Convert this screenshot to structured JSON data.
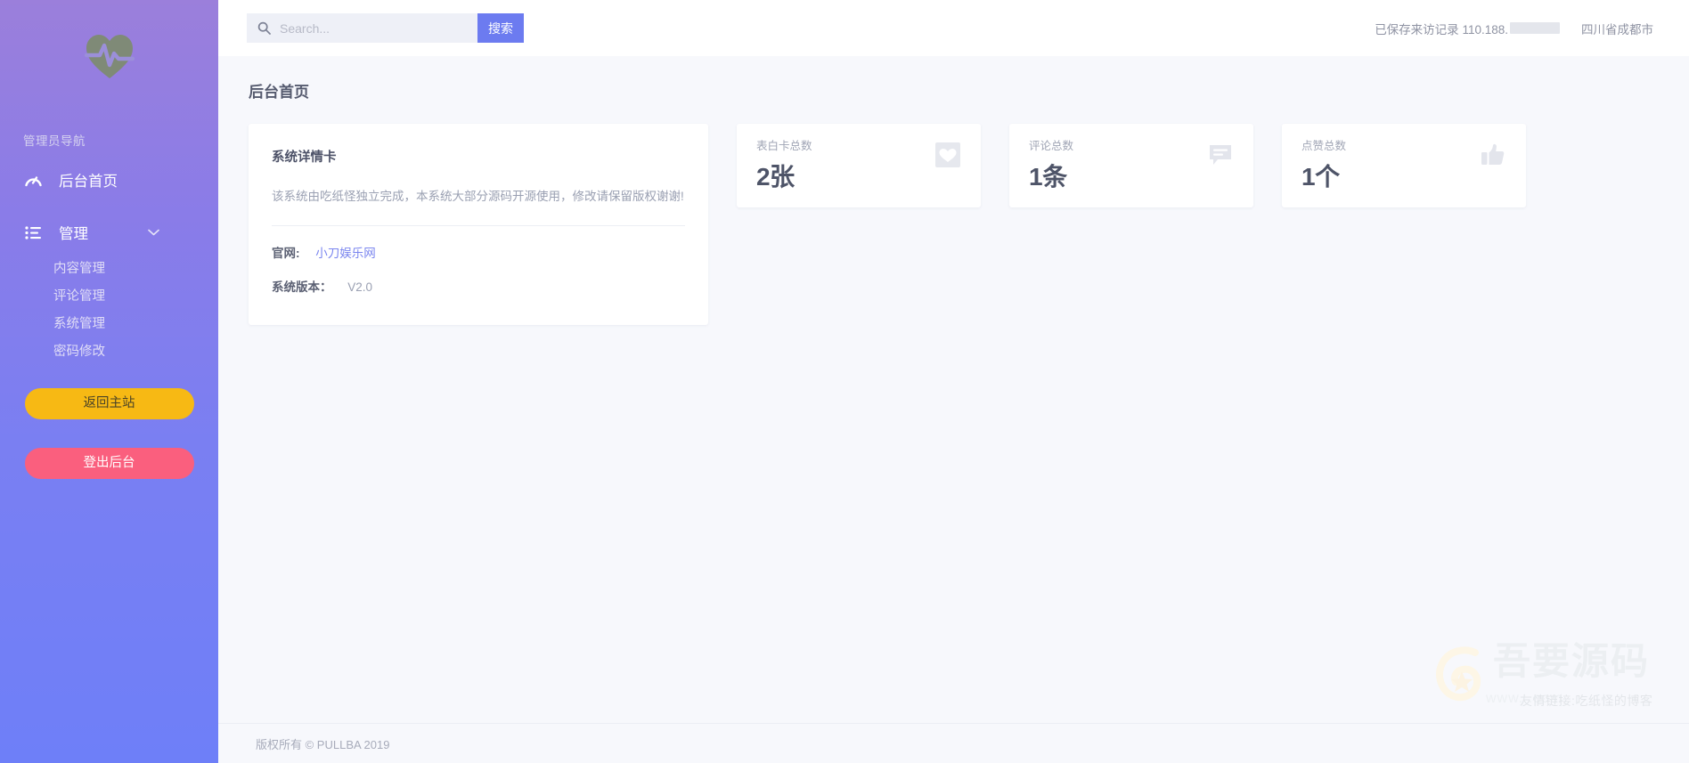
{
  "sidebar": {
    "logo_icon": "heart-pulse-logo",
    "nav_title": "管理员导航",
    "items": [
      {
        "label": "后台首页",
        "icon": "speedometer-icon"
      },
      {
        "label": "管理",
        "icon": "list-icon",
        "chevron": "⌄"
      }
    ],
    "sub_items": [
      {
        "label": "内容管理"
      },
      {
        "label": "评论管理"
      },
      {
        "label": "系统管理"
      },
      {
        "label": "密码修改"
      }
    ],
    "home_button": "返回主站",
    "logout_button": "登出后台",
    "home_button_color": "#f7b914",
    "logout_button_color": "#fa5f7e",
    "gradient_top": "#9b7fdb",
    "gradient_bottom": "#6e7ff8"
  },
  "topbar": {
    "search_placeholder": "Search...",
    "search_value": "",
    "search_button": "搜索",
    "search_button_color": "#6c7bf0",
    "visit_record_prefix": "已保存来访记录 110.188.",
    "region": "四川省成都市"
  },
  "content": {
    "page_title": "后台首页",
    "detail_card": {
      "title": "系统详情卡",
      "description": "该系统由吃纸怪独立完成，本系统大部分源码开源使用，修改请保留版权谢谢!",
      "fields": [
        {
          "key": "官网:",
          "value": "小刀娱乐网",
          "is_link": true
        },
        {
          "key": "系统版本：",
          "value": "V2.0",
          "is_link": false
        }
      ]
    },
    "stats": [
      {
        "label": "表白卡总数",
        "value": "2张",
        "icon": "heart-square-icon"
      },
      {
        "label": "评论总数",
        "value": "1条",
        "icon": "comment-icon"
      },
      {
        "label": "点赞总数",
        "value": "1个",
        "icon": "thumbs-up-icon"
      }
    ]
  },
  "footer": {
    "copyright": "版权所有 © PULLBA 2019"
  },
  "watermark": {
    "title": "吾要源码",
    "url": "www.                 .com",
    "subtitle": "友情链接:吃纸怪的博客"
  }
}
